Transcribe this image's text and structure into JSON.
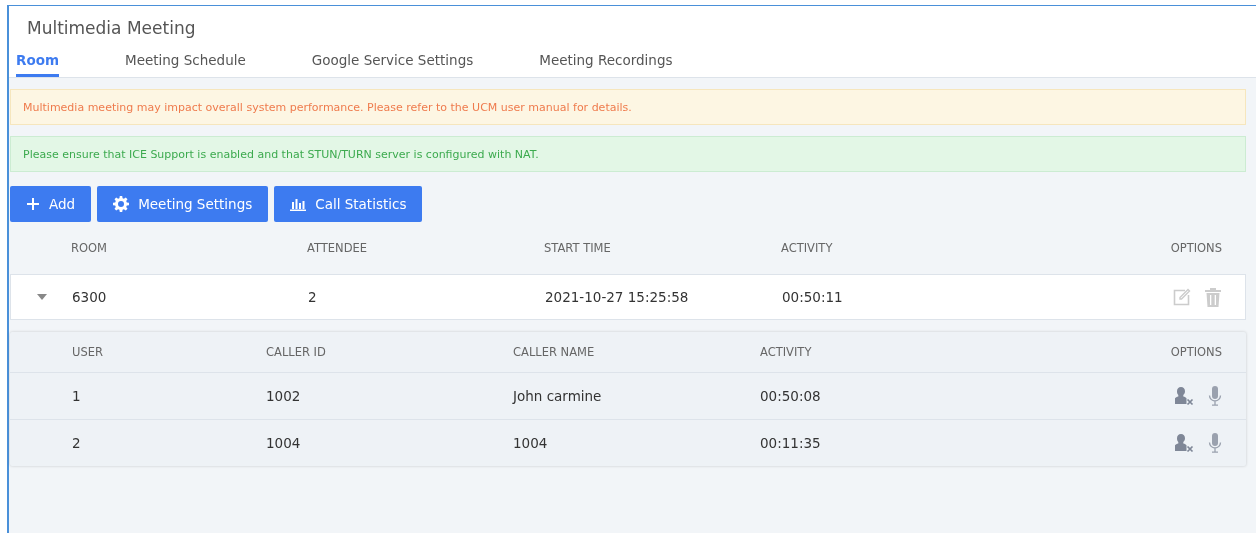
{
  "window": {
    "title": "Multimedia Meeting"
  },
  "tabs": [
    {
      "label": "Room",
      "selected": true
    },
    {
      "label": "Meeting Schedule",
      "selected": false
    },
    {
      "label": "Google Service Settings",
      "selected": false
    },
    {
      "label": "Meeting Recordings",
      "selected": false
    }
  ],
  "notices": [
    {
      "kind": "warning",
      "text": "Multimedia meeting may impact overall system performance. Please refer to the UCM user manual for details."
    },
    {
      "kind": "info",
      "text": "Please ensure that ICE Support is enabled and that STUN/TURN server is configured with NAT."
    }
  ],
  "toolbar": [
    {
      "kind": "add",
      "label": "Add"
    },
    {
      "kind": "settings",
      "label": "Meeting Settings"
    },
    {
      "kind": "stats",
      "label": "Call Statistics"
    }
  ],
  "table": {
    "columns": [
      "ROOM",
      "ATTENDEE",
      "START TIME",
      "ACTIVITY",
      "OPTIONS"
    ],
    "rows": [
      {
        "room": "6300",
        "attendee": "2",
        "start_time": "2021-10-27 15:25:58",
        "activity": "00:50:11",
        "expanded": true,
        "members": {
          "columns": [
            "USER",
            "CALLER ID",
            "CALLER NAME",
            "ACTIVITY",
            "OPTIONS"
          ],
          "rows": [
            {
              "user": "1",
              "caller_id": "1002",
              "caller_name": "John carmine",
              "activity": "00:50:08"
            },
            {
              "user": "2",
              "caller_id": "1004",
              "caller_name": "1004",
              "activity": "00:11:35"
            }
          ]
        }
      }
    ]
  }
}
